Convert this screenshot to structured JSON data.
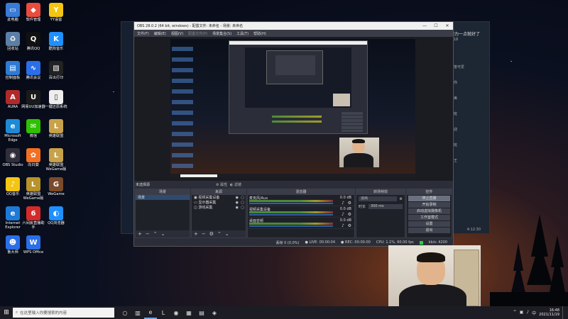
{
  "desktop_icons": [
    {
      "label": "此电脑",
      "color": "#3a7bd5",
      "glyph": "▭"
    },
    {
      "label": "软件管理",
      "color": "#e94c3d",
      "glyph": "◆"
    },
    {
      "label": "YY语音",
      "color": "#f3c614",
      "glyph": "Y"
    },
    {
      "label": "回收站",
      "color": "#5b7fa6",
      "glyph": "♻"
    },
    {
      "label": "腾讯QQ",
      "color": "#111111",
      "glyph": "Q"
    },
    {
      "label": "酷狗音乐",
      "color": "#1e90ff",
      "glyph": "K"
    },
    {
      "label": "控制面板",
      "color": "#2f7bd3",
      "glyph": "▤"
    },
    {
      "label": "腾讯会议",
      "color": "#2a6fe8",
      "glyph": "∿"
    },
    {
      "label": "百出打印",
      "color": "#222222",
      "glyph": "▧"
    },
    {
      "label": "AURA",
      "color": "#b02a2a",
      "glyph": "A"
    },
    {
      "label": "网易UU加速器",
      "color": "#1a1a1a",
      "glyph": "U"
    },
    {
      "label": "一键还原系统",
      "color": "#eeeeee",
      "glyph": "▯"
    },
    {
      "label": "Microsoft Edge",
      "color": "#1e8ad6",
      "glyph": "e"
    },
    {
      "label": "微信",
      "color": "#2dc100",
      "glyph": "✉"
    },
    {
      "label": "英雄联盟",
      "color": "#c8a24a",
      "glyph": "L"
    },
    {
      "label": "OBS Studio",
      "color": "#302e3a",
      "glyph": "◉"
    },
    {
      "label": "向日葵",
      "color": "#f36f21",
      "glyph": "✿"
    },
    {
      "label": "英雄联盟WeGame版",
      "color": "#c8a24a",
      "glyph": "L"
    },
    {
      "label": "QQ音乐",
      "color": "#f3c614",
      "glyph": "♪"
    },
    {
      "label": "英雄联盟WeGame版",
      "color": "#b8922a",
      "glyph": "L"
    },
    {
      "label": "WeGame",
      "color": "#7a4a2a",
      "glyph": "G"
    },
    {
      "label": "Internet Explorer",
      "color": "#1e7ad6",
      "glyph": "e"
    },
    {
      "label": "六间房直播助手",
      "color": "#d62a2a",
      "glyph": "6"
    },
    {
      "label": "QQ浏览器",
      "color": "#1e90ff",
      "glyph": "◐"
    },
    {
      "label": "鲁大师",
      "color": "#2a6fe8",
      "glyph": "☻"
    },
    {
      "label": "WPS Office",
      "color": "#2a6fe8",
      "glyph": "W"
    }
  ],
  "chat_app": {
    "headline": "努力一点就好了",
    "time": "0:18",
    "items": [
      "解答可爱",
      "迎你",
      "好美",
      "上班",
      "欢迎",
      "上班",
      "加王"
    ],
    "counter": "4:12:30"
  },
  "obs": {
    "title": "OBS 28.0.2 (64 bit, windows) - 配置文件: 未命名 - 场景: 未命名",
    "window_controls": [
      "—",
      "☐",
      "✕"
    ],
    "menu": [
      "文件(F)",
      "编辑(E)",
      "视图(V)",
      "配置文件(P)",
      "场景集合(S)",
      "工具(T)",
      "帮助(H)"
    ],
    "scene_bar": {
      "label": "未选择源",
      "buttons": [
        "⚙ 属性",
        "◐ 滤镜"
      ]
    },
    "docks": {
      "scenes": {
        "title": "场景",
        "items": [
          "场景"
        ]
      },
      "sources": {
        "title": "来源",
        "items": [
          "视频采集设备",
          "显示器采集",
          "游戏采集"
        ]
      },
      "mixer": {
        "title": "混音器",
        "rows": [
          {
            "name": "麦克风/Aux",
            "db": "0.0 dB"
          },
          {
            "name": "视频采集设备",
            "db": "0.0 dB"
          },
          {
            "name": "桌面音频",
            "db": "0.0 dB"
          }
        ]
      },
      "transitions": {
        "title": "转场特效",
        "type": "淡出",
        "duration_label": "时长",
        "duration": "300 ms"
      },
      "controls": {
        "title": "控件",
        "buttons": [
          "停止直播",
          "开始录制",
          "启动虚拟摄像机",
          "工作室模式",
          "设置",
          "退出"
        ]
      }
    },
    "status": {
      "dropped": "丢帧 0 (0.0%)",
      "live": "LIVE: 00:00:04",
      "rec": "REC: 00:00:00",
      "cpu": "CPU: 1.1%, 60.00 fps",
      "bitrate": "kb/s: 4200"
    }
  },
  "taskbar": {
    "start_glyph": "⊞",
    "search_placeholder": "在这里输入你要搜索的内容",
    "apps": [
      "○",
      "▥",
      "e",
      "L",
      "◉",
      "▦",
      "▤",
      "◈"
    ],
    "tray_icons": [
      "^",
      "▣",
      "♪",
      "中"
    ],
    "time": "16:48",
    "date": "2021/11/19"
  },
  "colors": {
    "obs_bg": "#2b2e38",
    "live_indicator": "#2ecc40",
    "accent": "#2f5fa0"
  }
}
